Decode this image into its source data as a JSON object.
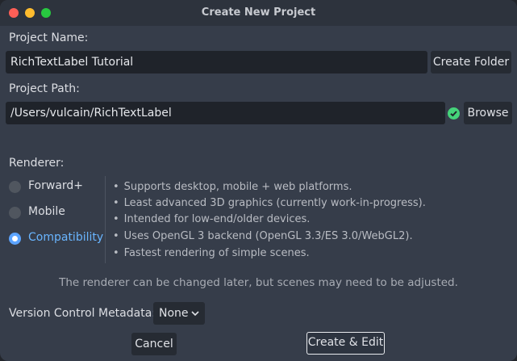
{
  "window": {
    "title": "Create New Project"
  },
  "project_name": {
    "label": "Project Name:",
    "value": "RichTextLabel Tutorial",
    "create_folder_label": "Create Folder"
  },
  "project_path": {
    "label": "Project Path:",
    "value": "/Users/vulcain/RichTextLabel",
    "browse_label": "Browse",
    "status_icon": "check-circle-icon"
  },
  "renderer": {
    "label": "Renderer:",
    "options": [
      {
        "label": "Forward+",
        "selected": false
      },
      {
        "label": "Mobile",
        "selected": false
      },
      {
        "label": "Compatibility",
        "selected": true
      }
    ],
    "description": [
      "Supports desktop, mobile + web platforms.",
      "Least advanced 3D graphics (currently work-in-progress).",
      "Intended for low-end/older devices.",
      "Uses OpenGL 3 backend (OpenGL 3.3/ES 3.0/WebGL2).",
      "Fastest rendering of simple scenes."
    ],
    "note": "The renderer can be changed later, but scenes may need to be adjusted."
  },
  "version_control": {
    "label": "Version Control Metadata:",
    "value": "None"
  },
  "buttons": {
    "cancel": "Cancel",
    "create": "Create & Edit"
  },
  "colors": {
    "accent": "#5ca4ff",
    "ok": "#45d37a",
    "background": "#363d4a"
  }
}
